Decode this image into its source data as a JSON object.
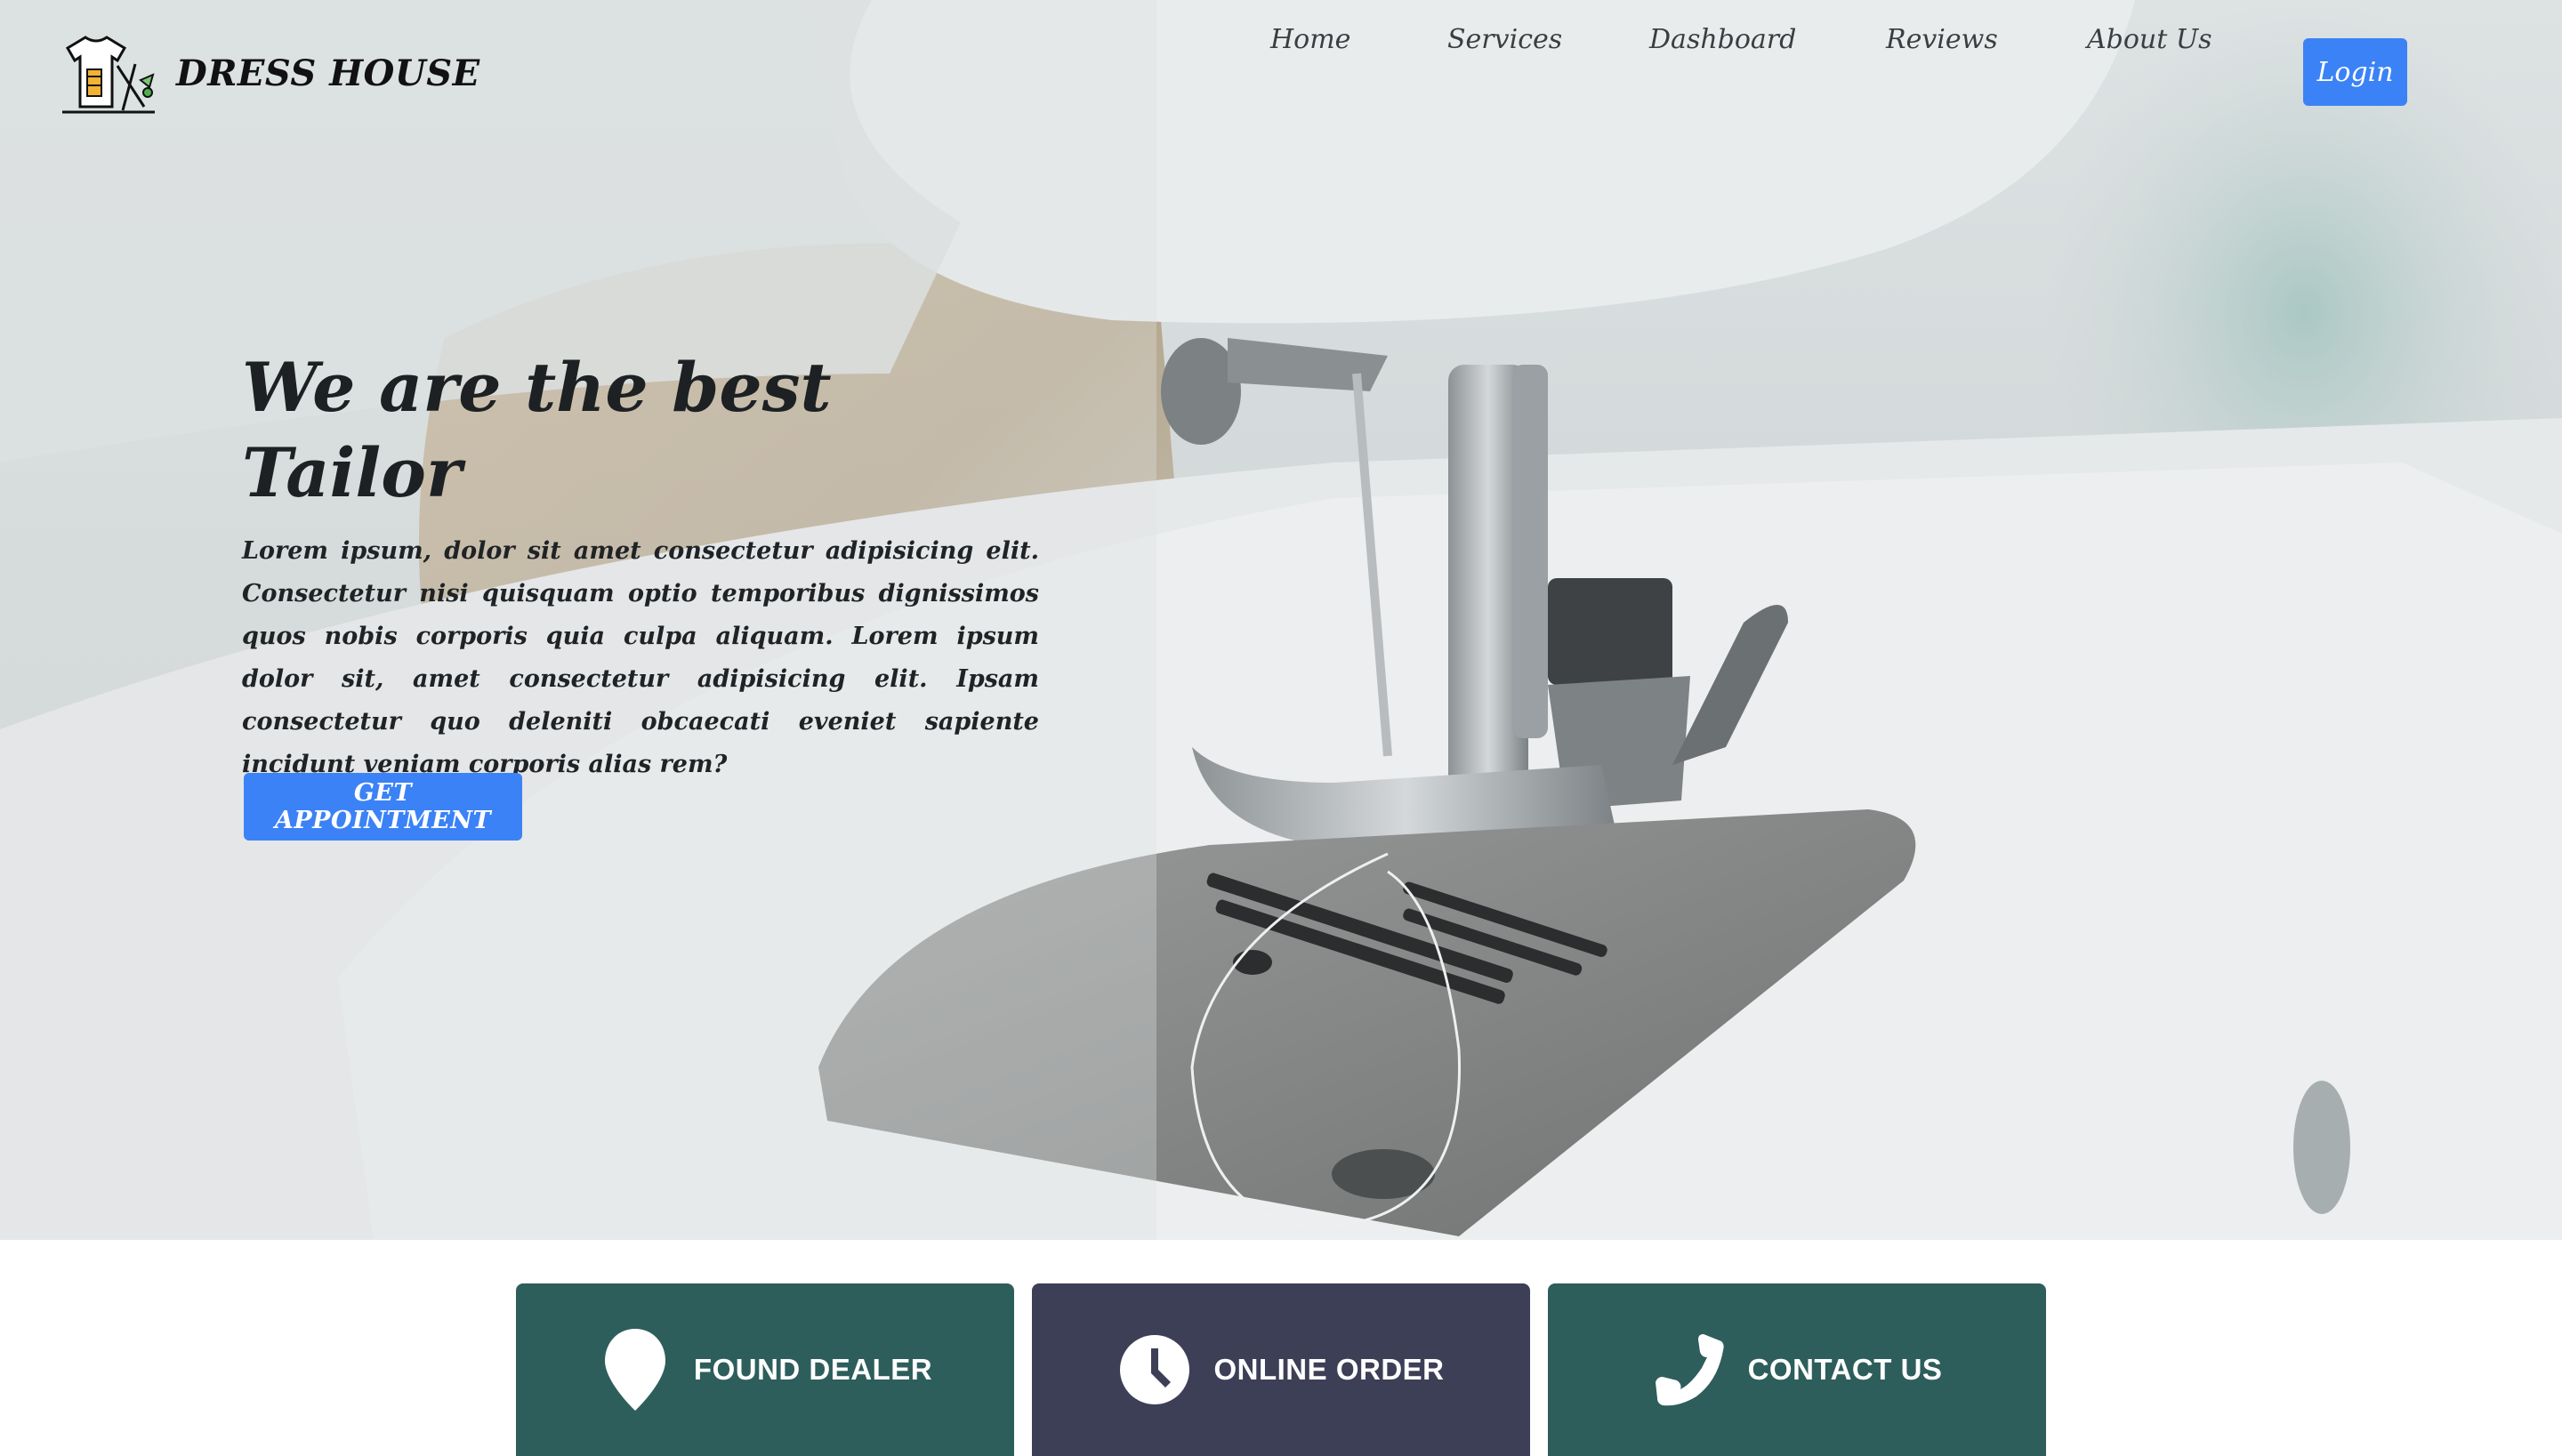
{
  "brand": {
    "name": "DRESS HOUSE",
    "logo_icon": "tailor-shirt-needle-icon"
  },
  "nav": {
    "links": [
      "Home",
      "Services",
      "Dashboard",
      "Reviews",
      "About Us"
    ],
    "login_label": "Login"
  },
  "hero": {
    "title_line1": "We are the best",
    "title_line2": "Tailor",
    "description": "Lorem ipsum, dolor sit amet consectetur adipisicing elit. Consectetur nisi quisquam optio temporibus dignissimos quos nobis corporis quia culpa aliquam. Lorem ipsum dolor sit, amet consectetur adipisicing elit. Ipsam consectetur quo deleniti obcaecati eveniet sapiente incidunt veniam corporis alias rem?",
    "cta_label": "GET APPOINTMENT",
    "background": "sewing-machine-photo"
  },
  "features": [
    {
      "label": "FOUND DEALER",
      "icon": "map-pin-icon"
    },
    {
      "label": "ONLINE ORDER",
      "icon": "clock-icon"
    },
    {
      "label": "CONTACT US",
      "icon": "phone-icon"
    }
  ],
  "colors": {
    "primary_button": "#3b82f6",
    "card_teal": "#2d5e5b",
    "card_slate": "#3d3f57"
  }
}
